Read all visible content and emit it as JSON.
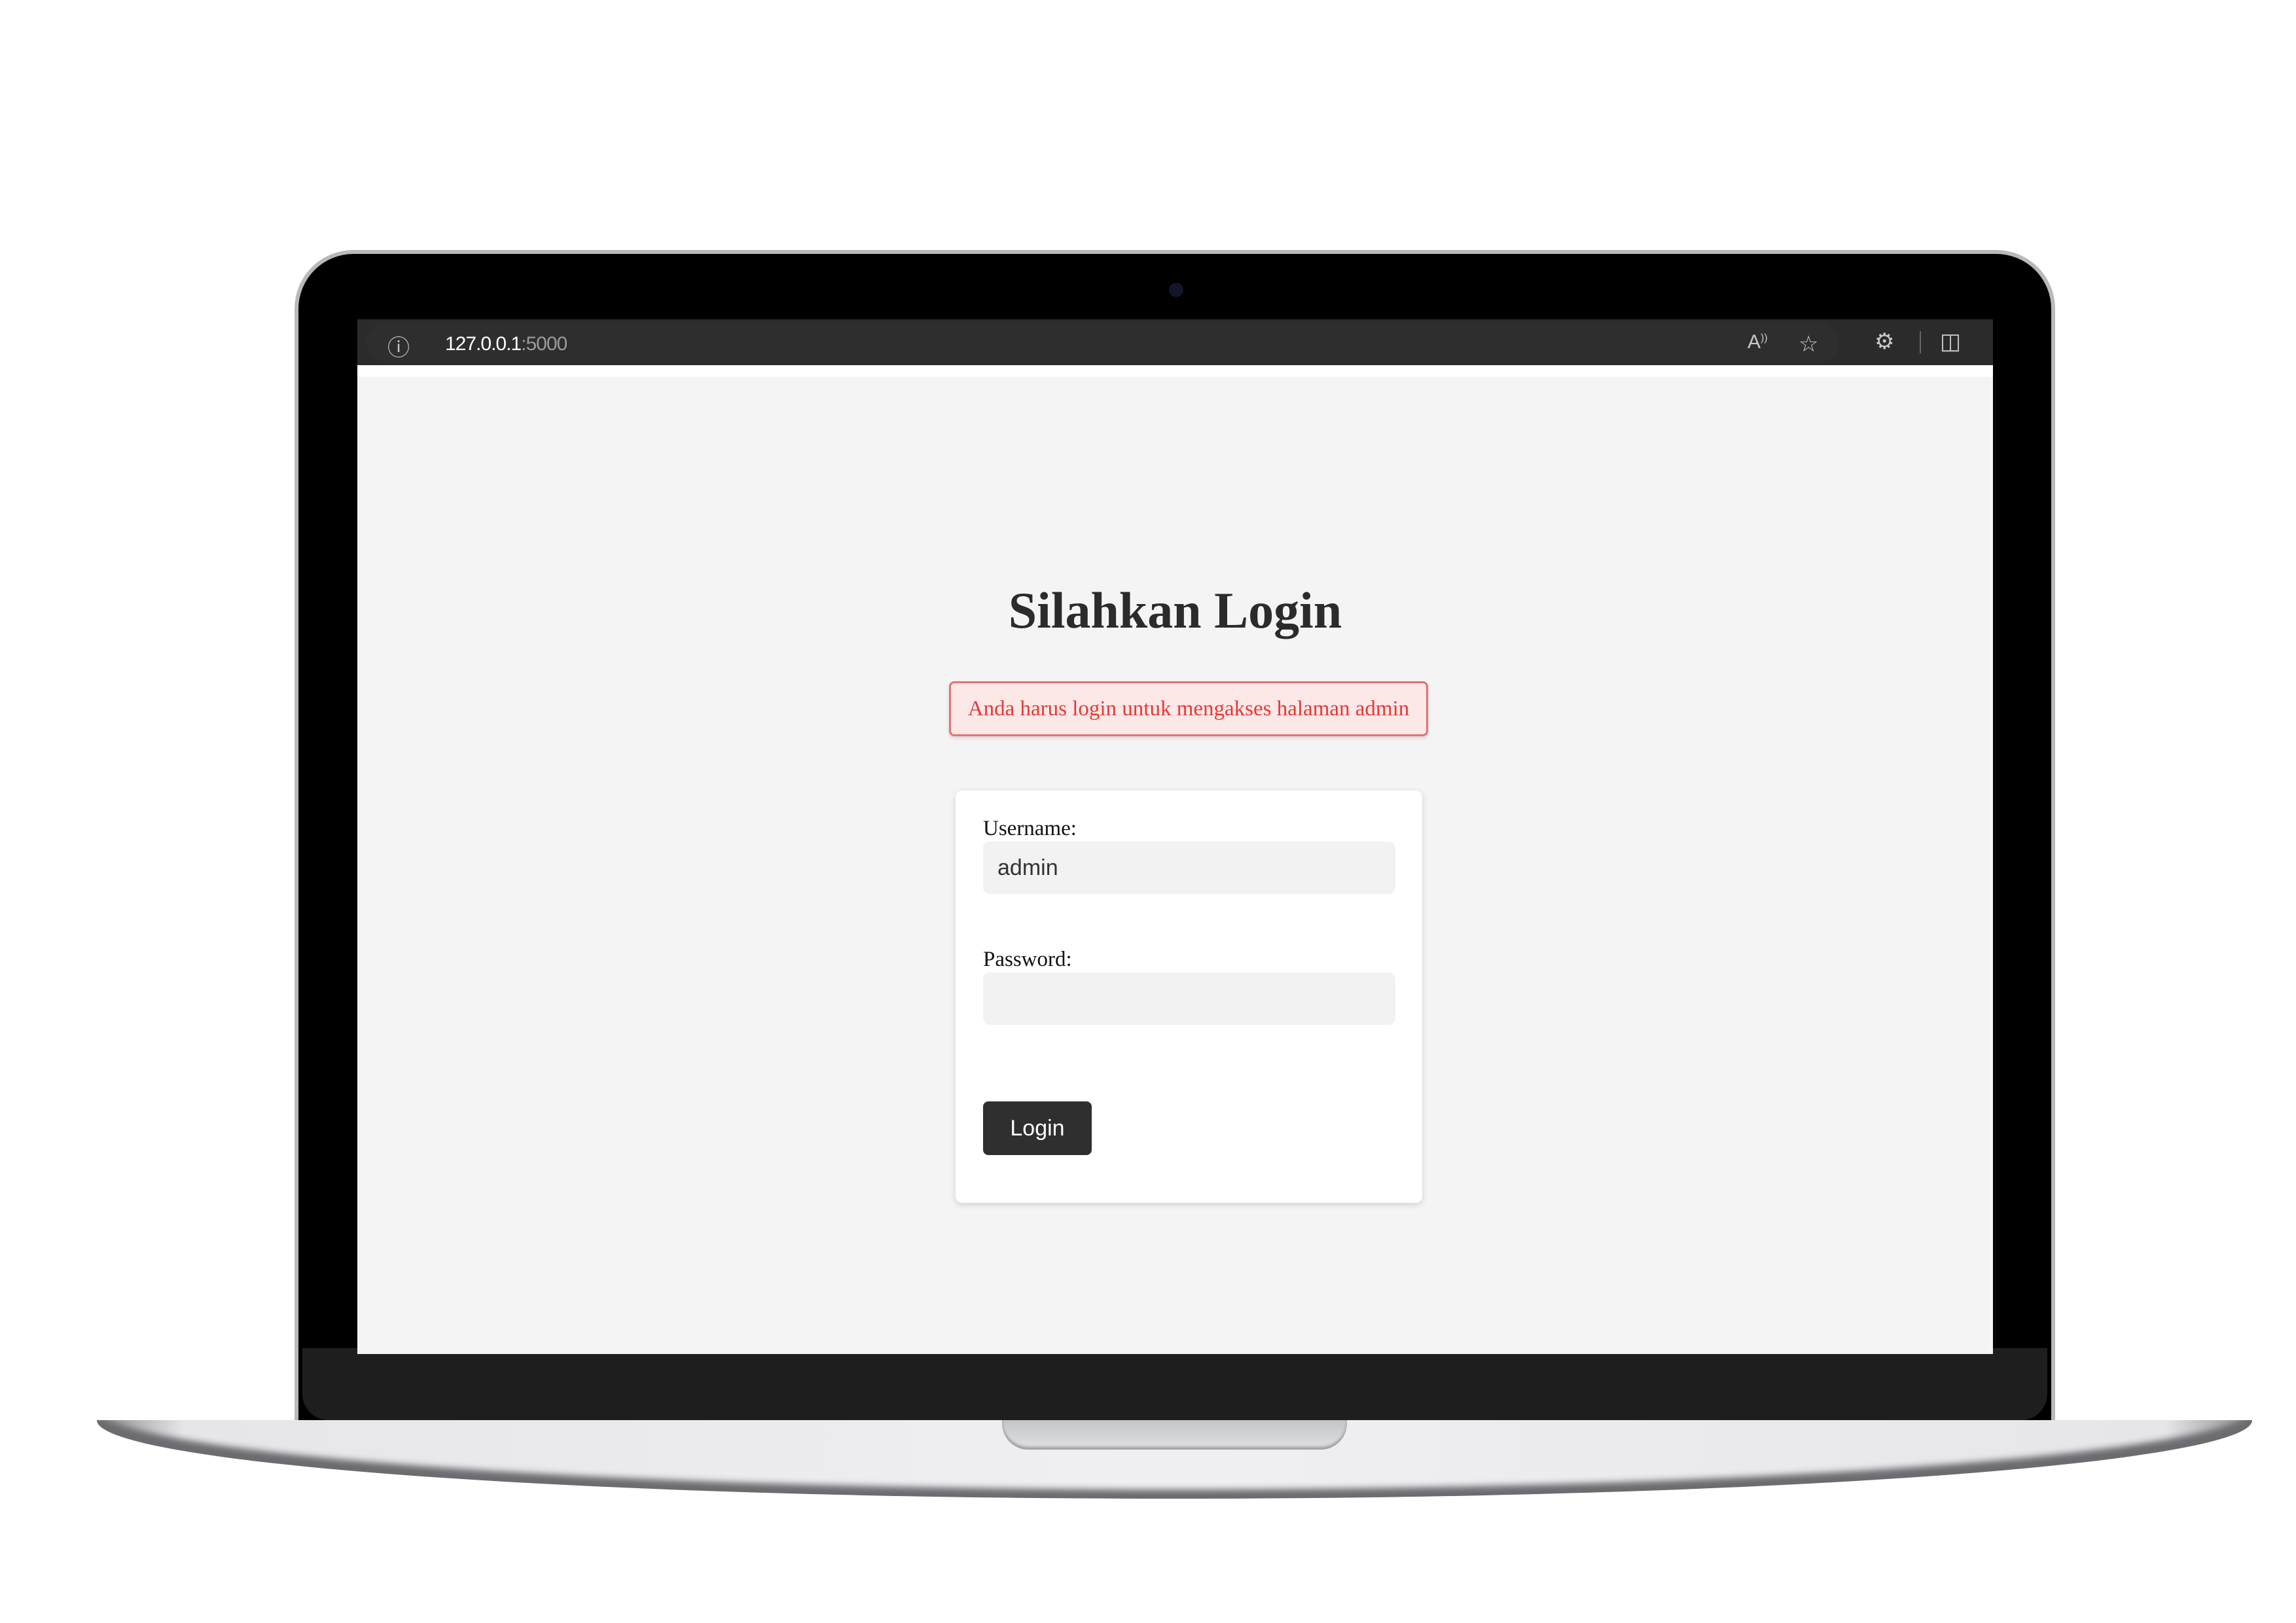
{
  "browser": {
    "url_host": "127.0.0.1",
    "url_port": ":5000",
    "icons": [
      "info-icon",
      "read-aloud-icon",
      "favorite-star-icon",
      "extensions-icon",
      "split-screen-icon"
    ]
  },
  "page": {
    "title": "Silahkan Login",
    "alert": "Anda harus login untuk mengakses halaman admin",
    "colors": {
      "alert_text": "#e53935",
      "alert_bg": "#fde8e8",
      "button_bg": "#2f2f2f",
      "page_bg": "#f4f4f4"
    }
  },
  "form": {
    "username_label": "Username:",
    "username_value": "admin",
    "password_label": "Password:",
    "password_value": "",
    "login_label": "Login"
  }
}
